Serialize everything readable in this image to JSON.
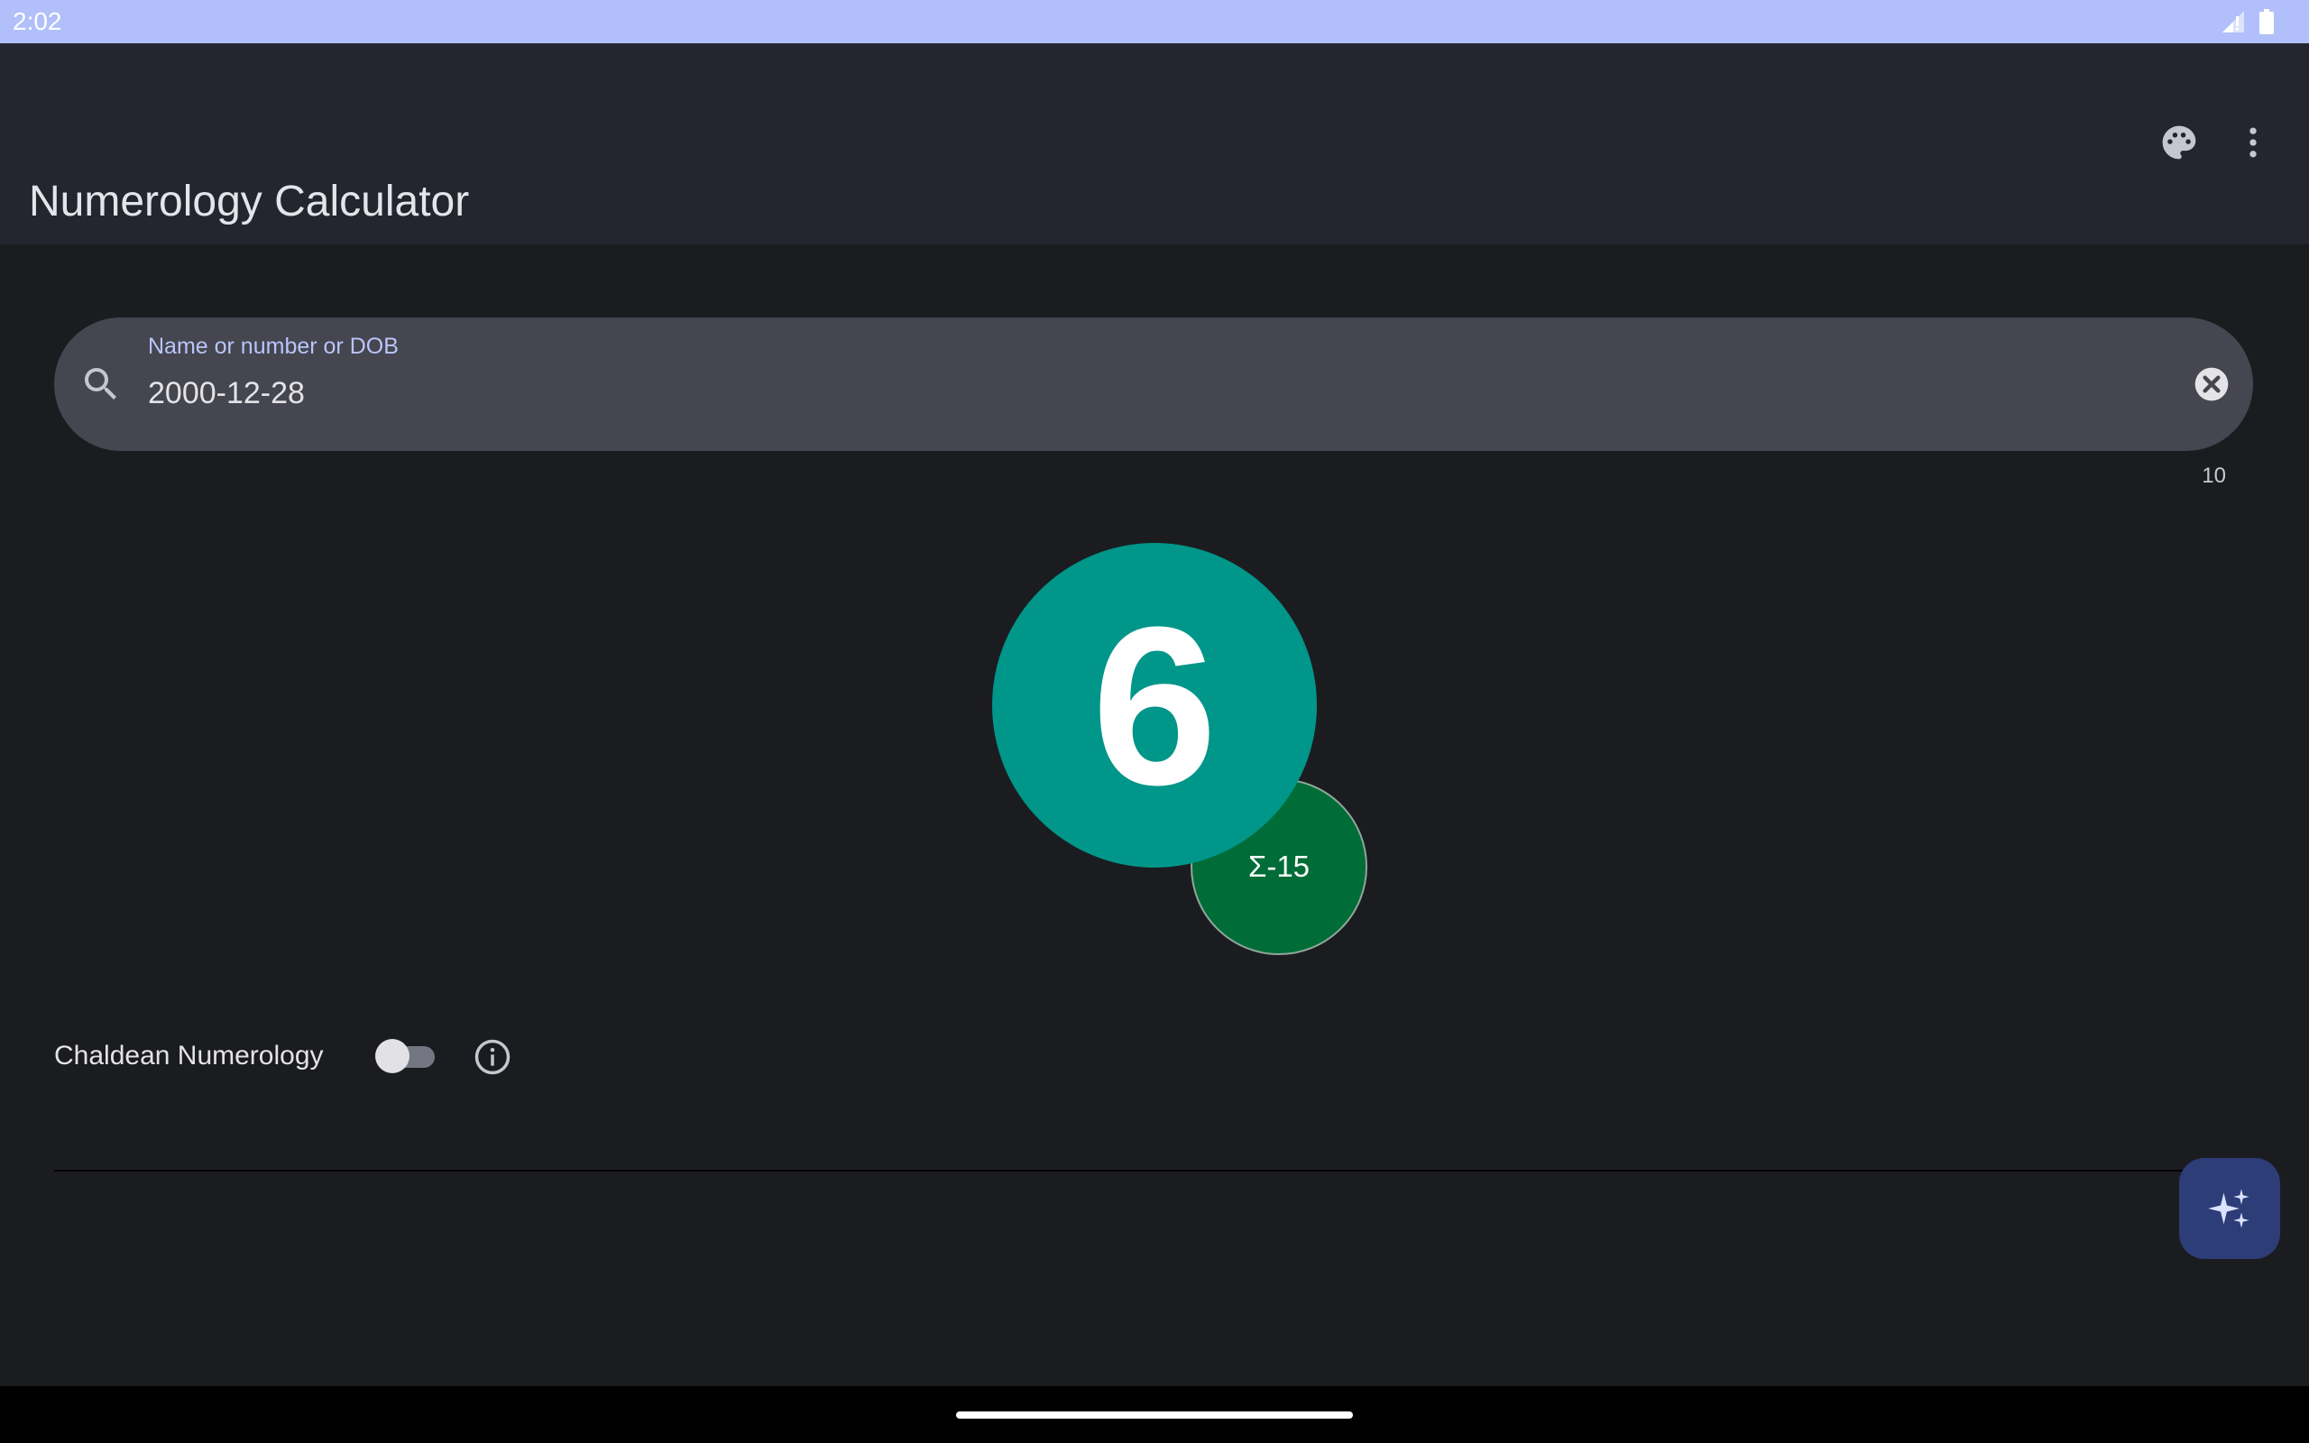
{
  "status_bar": {
    "time": "2:02"
  },
  "app_bar": {
    "title": "Numerology Calculator",
    "actions": [
      "palette-icon",
      "more-vert-icon"
    ]
  },
  "search": {
    "label": "Name or number or DOB",
    "value": "2000-12-28",
    "char_count": "10"
  },
  "result": {
    "number": "6",
    "sum": "Σ-15"
  },
  "settings": {
    "chaldean_label": "Chaldean Numerology",
    "chaldean_enabled": false
  },
  "colors": {
    "status_bar": "#b1c0fb",
    "app_bar": "#24262f",
    "background": "#1b1c20",
    "search_box": "#45464f",
    "result_circle": "#009689",
    "sum_circle": "#006c37",
    "fab": "#2c3d78"
  },
  "fab": {
    "icon": "sparkle-icon"
  }
}
